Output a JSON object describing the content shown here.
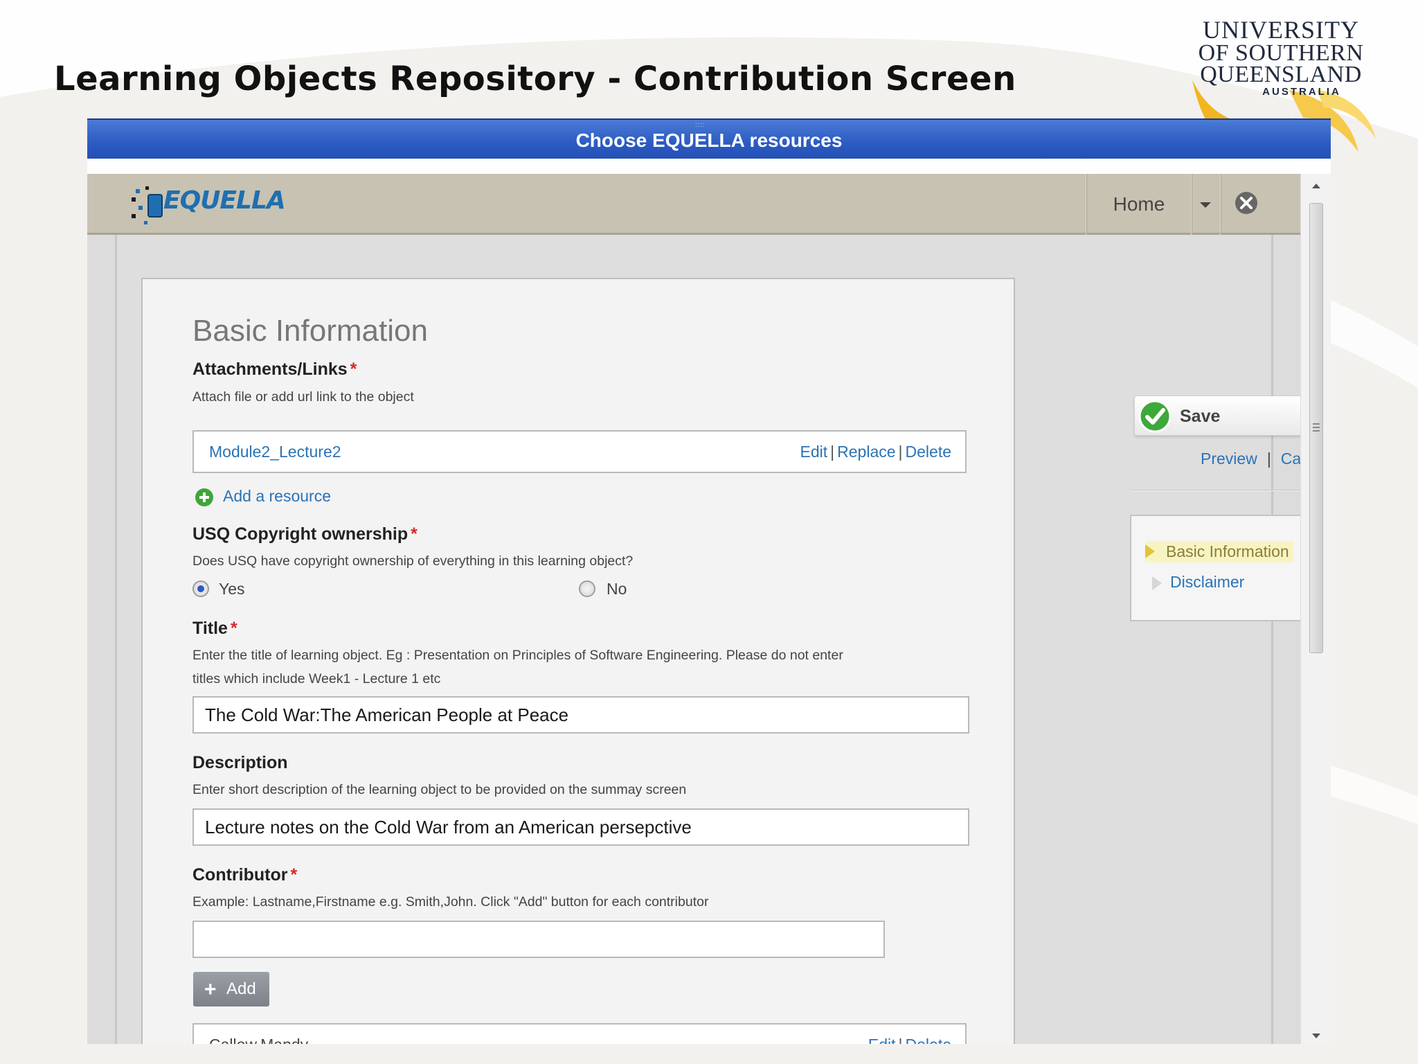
{
  "slide": {
    "title": "Learning Objects Repository -  Contribution Screen"
  },
  "university_logo": {
    "line1": "UNIVERSITY",
    "line2": "OF SOUTHERN",
    "line3": "QUEENSLAND",
    "line4": "AUSTRALIA"
  },
  "dialog": {
    "title": "Choose EQUELLA resources"
  },
  "app_header": {
    "logo_text": "EQUELLA",
    "home_label": "Home"
  },
  "form": {
    "section_title": "Basic Information",
    "attachments": {
      "label": "Attachments/Links",
      "required": "*",
      "help": "Attach file or add url link to the object",
      "items": [
        {
          "name": "Module2_Lecture2",
          "edit": "Edit",
          "replace": "Replace",
          "delete": "Delete"
        }
      ],
      "add_resource": "Add a resource"
    },
    "copyright": {
      "label": "USQ Copyright ownership",
      "required": "*",
      "help": "Does USQ have copyright ownership of everything in this learning object?",
      "options": [
        "Yes",
        "No"
      ],
      "selected": "Yes"
    },
    "title_field": {
      "label": "Title",
      "required": "*",
      "help_line1": "Enter the title of learning object. Eg : Presentation on Principles of Software Engineering. Please do not enter",
      "help_line2": "titles which include Week1 - Lecture 1 etc",
      "value": "The Cold War:The American People at Peace"
    },
    "description": {
      "label": "Description",
      "help": "Enter short description of the learning object to be provided on the summay screen",
      "value": "Lecture notes on the Cold War from an American persepctive"
    },
    "contributor": {
      "label": "Contributor",
      "required": "*",
      "help": "Example: Lastname,Firstname e.g. Smith,John. Click \"Add\" button for each contributor",
      "value": "",
      "add_label": "Add",
      "items": [
        {
          "name": "Callow,Mandy",
          "edit": "Edit",
          "delete": "Delete"
        }
      ]
    }
  },
  "sidebar": {
    "save_label": "Save",
    "preview_label": "Preview",
    "cancel_label": "Cancel",
    "nav_items": [
      {
        "label": "Basic Information",
        "active": true
      },
      {
        "label": "Disclaimer",
        "active": false
      }
    ]
  },
  "colors": {
    "dialog_bar": "#2c5bc2",
    "header_bg": "#c8c2b3",
    "link": "#2a73b6",
    "required": "#d9282a",
    "active_nav_bg": "#f8f4c2"
  },
  "icons": [
    "equella-logo-icon",
    "chevron-down-icon",
    "close-icon",
    "check-icon",
    "plus-circle-icon",
    "plus-icon",
    "scroll-up-icon",
    "scroll-down-icon",
    "triangle-right-icon"
  ]
}
